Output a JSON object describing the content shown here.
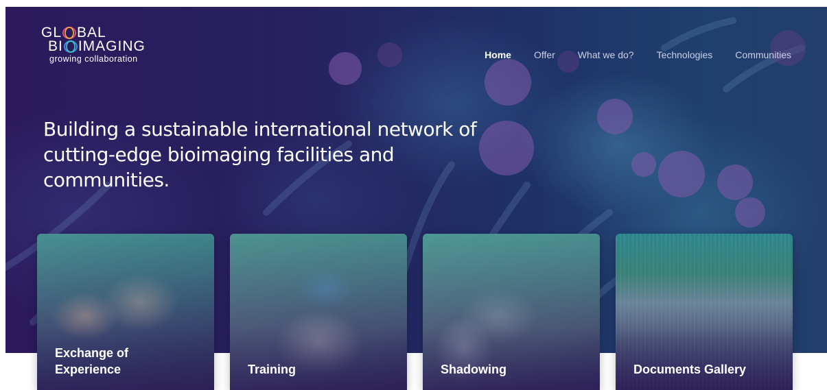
{
  "logo": {
    "line1": "GL BAL",
    "line2": "BI IMAGING",
    "tagline": "growing collaboration"
  },
  "nav": {
    "items": [
      {
        "label": "Home",
        "active": true
      },
      {
        "label": "Offer",
        "active": false
      },
      {
        "label": "What we do?",
        "active": false
      },
      {
        "label": "Technologies",
        "active": false
      },
      {
        "label": "Communities",
        "active": false
      }
    ]
  },
  "hero": {
    "headline": "Building a sustainable international network of cutting-edge bioimaging facilities and communities."
  },
  "cards": [
    {
      "title_line1": "Exchange of",
      "title_line2": "Experience"
    },
    {
      "title_line1": "Training",
      "title_line2": ""
    },
    {
      "title_line1": "Shadowing",
      "title_line2": ""
    },
    {
      "title_line1": "Documents Gallery",
      "title_line2": ""
    }
  ],
  "colors": {
    "hero_purple": "#2b1a5c",
    "hero_blue": "#1f3f6e",
    "nav_inactive": "#c9d0e6",
    "text_white": "#ffffff"
  }
}
